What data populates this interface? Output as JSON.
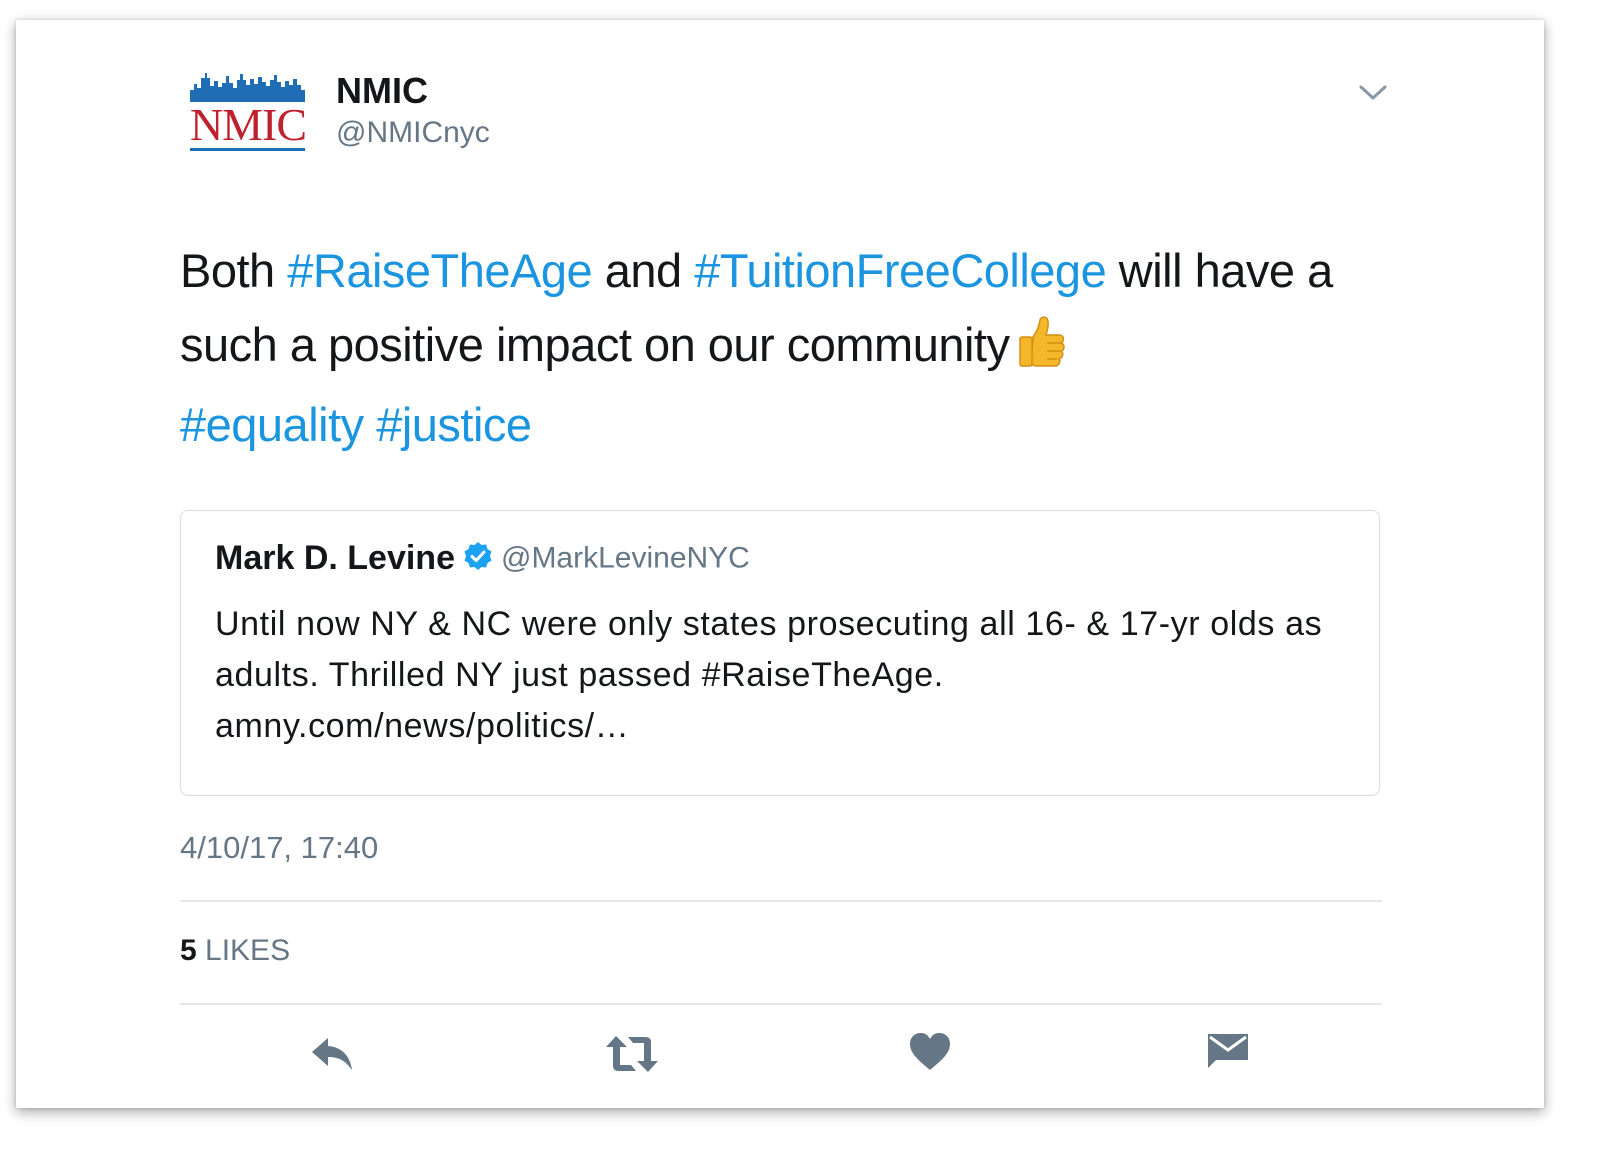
{
  "author": {
    "logo_text": "NMIC",
    "name": "NMIC",
    "handle": "@NMICnyc"
  },
  "tweet": {
    "text_parts": {
      "p1": "Both ",
      "h1": "#RaiseTheAge",
      "p2": " and ",
      "h2": "#TuitionFreeCollege",
      "p3": " will have a such a positive impact on our community",
      "h3": "#equality",
      "p4": " ",
      "h4": "#justice"
    },
    "emoji": "thumbs-up"
  },
  "quoted_tweet": {
    "name": "Mark D. Levine",
    "handle": "@MarkLevineNYC",
    "verified": true,
    "text": "Until now NY & NC were only states prosecuting all 16- & 17-yr olds as adults. Thrilled NY just passed #RaiseTheAge. amny.com/news/politics/…"
  },
  "timestamp": "4/10/17, 17:40",
  "stats": {
    "likes_count": "5",
    "likes_label": "LIKES"
  },
  "actions": [
    {
      "icon": "reply-icon"
    },
    {
      "icon": "retweet-icon"
    },
    {
      "icon": "heart-icon"
    },
    {
      "icon": "direct-message-icon"
    }
  ],
  "colors": {
    "link": "#1b95e0",
    "text": "#14171a",
    "secondary": "#657786",
    "icon": "#657786",
    "logo_red": "#c0202e",
    "logo_blue": "#1f6db5"
  }
}
